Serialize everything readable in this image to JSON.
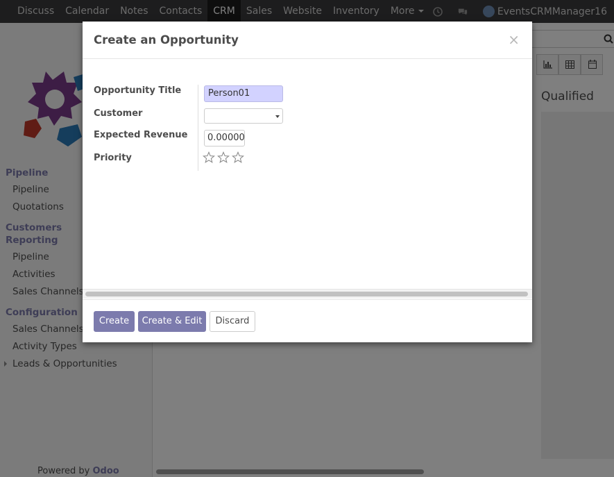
{
  "navbar": {
    "items": [
      {
        "label": "Discuss"
      },
      {
        "label": "Calendar"
      },
      {
        "label": "Notes"
      },
      {
        "label": "Contacts"
      },
      {
        "label": "CRM",
        "active": true
      },
      {
        "label": "Sales"
      },
      {
        "label": "Website"
      },
      {
        "label": "Inventory"
      },
      {
        "label": "More"
      }
    ],
    "user": "EventsCRMManager16"
  },
  "sidebar": {
    "sections": [
      {
        "title": "Pipeline",
        "items": [
          "Pipeline",
          "Quotations"
        ]
      },
      {
        "title": "Customers",
        "items": []
      },
      {
        "title": "Reporting",
        "items": [
          "Pipeline",
          "Activities",
          "Sales Channels"
        ]
      },
      {
        "title": "Configuration",
        "items": [
          "Sales Channels",
          "Activity Types",
          "Leads & Opportunities"
        ]
      }
    ],
    "powered_prefix": "Powered by",
    "powered_brand": "Odoo"
  },
  "main": {
    "stage_title": "Qualified"
  },
  "dialog": {
    "title": "Create an Opportunity",
    "close": "×",
    "fields": {
      "title_label": "Opportunity Title",
      "title_value": "Person01",
      "customer_label": "Customer",
      "customer_value": "",
      "revenue_label": "Expected Revenue",
      "revenue_value": "0.00000",
      "priority_label": "Priority",
      "priority_value": 0,
      "priority_max": 3
    },
    "buttons": {
      "create": "Create",
      "create_edit": "Create & Edit",
      "discard": "Discard"
    }
  },
  "colors": {
    "brand": "#7c7bad",
    "navbar": "#3a3a3c",
    "highlight_input": "#d2d2ff"
  }
}
